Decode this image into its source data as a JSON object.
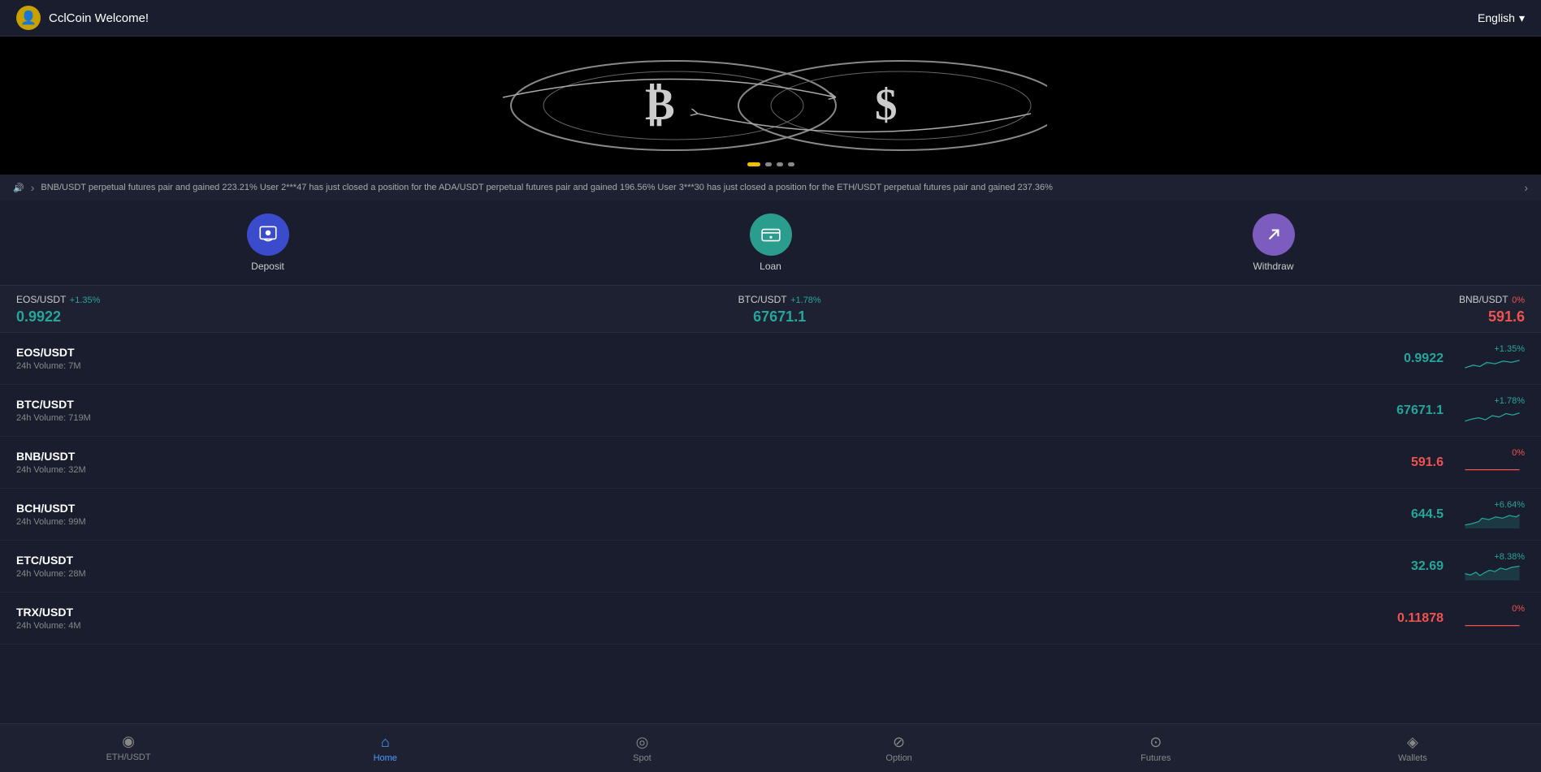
{
  "header": {
    "title": "CclCoin Welcome!",
    "language": "English",
    "avatar_symbol": "👤"
  },
  "banner": {
    "dots": [
      {
        "active": true
      },
      {
        "active": false
      },
      {
        "active": false
      },
      {
        "active": false
      }
    ]
  },
  "ticker": {
    "message": "BNB/USDT perpetual futures pair and gained 223.21% User 2***47 has just closed a position for the ADA/USDT perpetual futures pair and gained 196.56% User 3***30 has just closed a position for the ETH/USDT perpetual futures pair and gained 237.36%"
  },
  "quick_actions": [
    {
      "label": "Deposit",
      "icon_type": "deposit"
    },
    {
      "label": "Loan",
      "icon_type": "loan"
    },
    {
      "label": "Withdraw",
      "icon_type": "withdraw"
    }
  ],
  "price_ticker": [
    {
      "pair": "EOS/USDT",
      "change": "+1.35%",
      "price": "0.9922",
      "color": "green"
    },
    {
      "pair": "BTC/USDT",
      "change": "+1.78%",
      "price": "67671.1",
      "color": "green"
    },
    {
      "pair": "BNB/USDT",
      "change": "0%",
      "price": "591.6",
      "color": "red"
    }
  ],
  "market_rows": [
    {
      "pair": "EOS/USDT",
      "volume": "24h Volume: 7M",
      "price": "0.9922",
      "change": "+1.35%",
      "color": "green"
    },
    {
      "pair": "BTC/USDT",
      "volume": "24h Volume: 719M",
      "price": "67671.1",
      "change": "+1.78%",
      "color": "green"
    },
    {
      "pair": "BNB/USDT",
      "volume": "24h Volume: 32M",
      "price": "591.6",
      "change": "0%",
      "color": "red"
    },
    {
      "pair": "BCH/USDT",
      "volume": "24h Volume: 99M",
      "price": "644.5",
      "change": "+6.64%",
      "color": "green"
    },
    {
      "pair": "ETC/USDT",
      "volume": "24h Volume: 28M",
      "price": "32.69",
      "change": "+8.38%",
      "color": "green"
    },
    {
      "pair": "TRX/USDT",
      "volume": "24h Volume: 4M",
      "price": "0.11878",
      "change": "0%",
      "color": "red"
    }
  ],
  "bottom_nav": [
    {
      "label": "ETH/USDT",
      "icon": "◉",
      "active": false
    },
    {
      "label": "Home",
      "icon": "⌂",
      "active": true
    },
    {
      "label": "Spot",
      "icon": "◎",
      "active": false
    },
    {
      "label": "Option",
      "icon": "⊘",
      "active": false
    },
    {
      "label": "Futures",
      "icon": "⊙",
      "active": false
    },
    {
      "label": "Wallets",
      "icon": "◈",
      "active": false
    }
  ],
  "icons": {
    "deposit": "💼",
    "loan": "💳",
    "withdraw": "↗"
  }
}
